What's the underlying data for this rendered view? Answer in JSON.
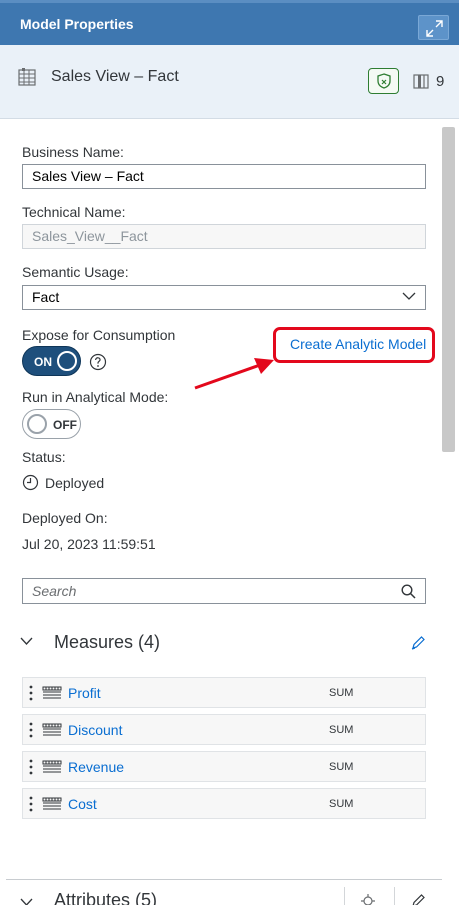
{
  "panel": {
    "title": "Model Properties",
    "object_title": "Sales View – Fact",
    "column_count": "9"
  },
  "form": {
    "business_name_label": "Business Name:",
    "business_name_value": "Sales View – Fact",
    "technical_name_label": "Technical Name:",
    "technical_name_value": "Sales_View__Fact",
    "semantic_usage_label": "Semantic Usage:",
    "semantic_usage_value": "Fact",
    "expose_label": "Expose for Consumption",
    "expose_toggle": "ON",
    "create_link": "Create Analytic Model",
    "analytical_mode_label": "Run in Analytical Mode:",
    "analytical_mode_toggle": "OFF",
    "status_label": "Status:",
    "status_value": "Deployed",
    "deployed_on_label": "Deployed On:",
    "deployed_on_value": "Jul 20, 2023 11:59:51"
  },
  "search": {
    "placeholder": "Search"
  },
  "measures": {
    "title": "Measures (4)",
    "items": [
      {
        "name": "Profit",
        "aggregation": "SUM"
      },
      {
        "name": "Discount",
        "aggregation": "SUM"
      },
      {
        "name": "Revenue",
        "aggregation": "SUM"
      },
      {
        "name": "Cost",
        "aggregation": "SUM"
      }
    ]
  },
  "attributes": {
    "title": "Attributes (5)"
  },
  "colors": {
    "header_bg": "#3e77b0",
    "object_header_bg": "#eaf1f8",
    "link": "#0a6ed1",
    "toggle_on": "#1e4f7c",
    "highlight": "#e3081c"
  },
  "icons": {
    "expand": "expand-icon",
    "table": "table-icon",
    "shield": "shield-icon",
    "columns": "columns-icon",
    "help": "help-icon",
    "clock": "clock-icon",
    "search": "search-icon",
    "measure": "measure-icon",
    "edit": "pencil-icon"
  }
}
